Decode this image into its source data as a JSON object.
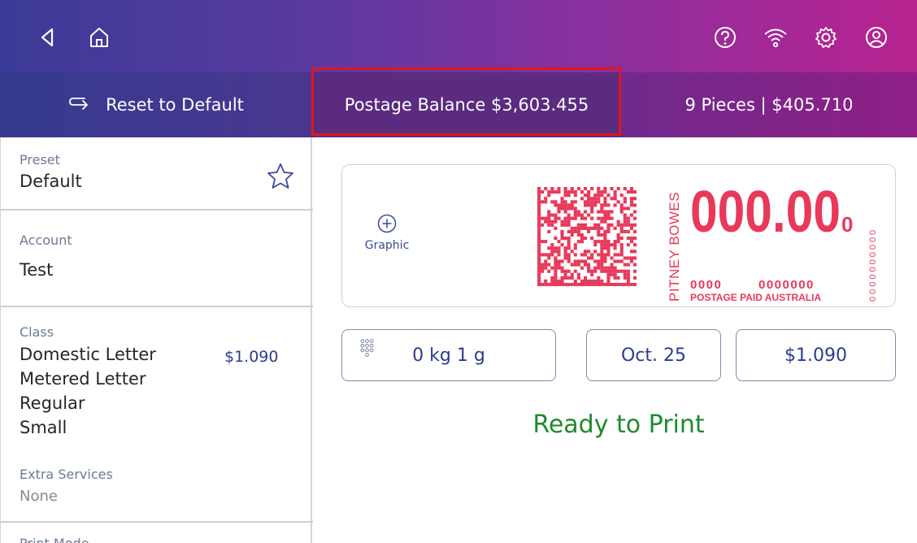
{
  "topbar": {
    "icons": [
      "back-icon",
      "home-icon",
      "help-icon",
      "wifi-icon",
      "settings-icon",
      "user-icon"
    ],
    "colors": {
      "gradient_start": "#3b3a97",
      "gradient_end": "#b8238f"
    }
  },
  "tabs": {
    "reset_label": "Reset to Default",
    "balance_label": "Postage Balance $3,603.455",
    "pieces_label": "9 Pieces | $405.710",
    "highlight_color": "#e0161c"
  },
  "sidebar": {
    "preset": {
      "label": "Preset",
      "value": "Default"
    },
    "account": {
      "label": "Account",
      "value": "Test"
    },
    "class": {
      "label": "Class",
      "lines": [
        "Domestic Letter",
        "Metered Letter",
        "Regular",
        "Small"
      ],
      "price": "$1.090",
      "extra_label": "Extra Services",
      "extra_value": "None"
    },
    "next_label": "Print Mode"
  },
  "indicia": {
    "graphic_label": "Graphic",
    "brand": "PITNEY BOWES",
    "amount_main": "000.00",
    "amount_small": "0",
    "code_left": "0000",
    "code_right": "0000000",
    "footer": "POSTAGE PAID AUSTRALIA",
    "side_digits": "0000000000",
    "color": "#e8395a"
  },
  "fields": {
    "weight": "0 kg 1 g",
    "date": "Oct. 25",
    "postage": "$1.090"
  },
  "status": {
    "text": "Ready to Print",
    "color": "#1f8a2c"
  }
}
